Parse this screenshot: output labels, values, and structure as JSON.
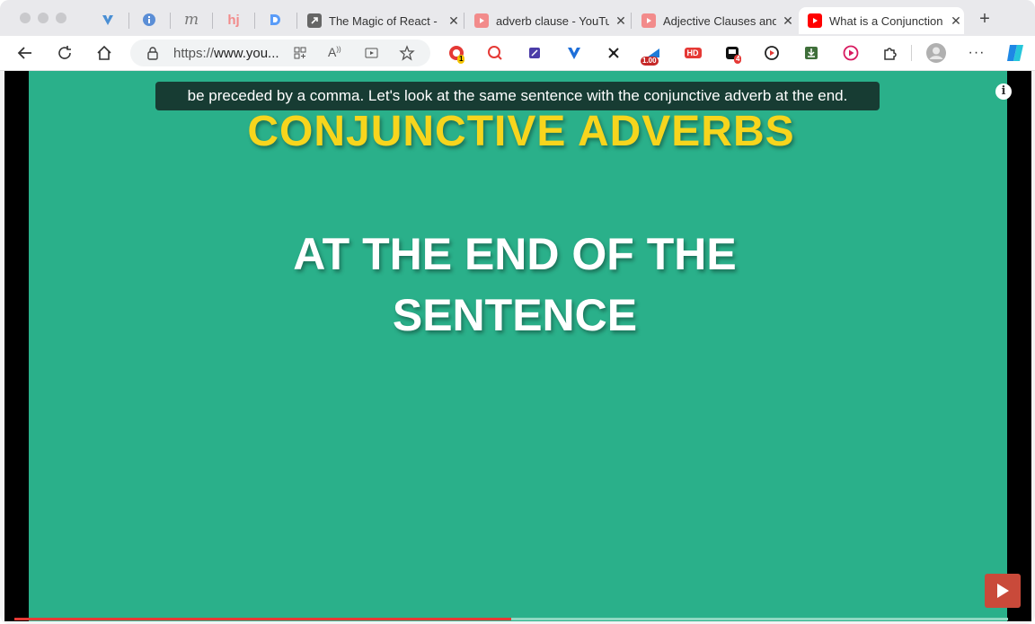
{
  "browser": {
    "pinned_tabs": [
      {
        "icon": "vuetify-icon",
        "color": "#4a8fd4"
      },
      {
        "icon": "info-icon",
        "color": "#5b8ed6"
      },
      {
        "icon": "m-letter-icon",
        "color": "#777777"
      },
      {
        "icon": "hj-icon",
        "color": "#f28b8b"
      },
      {
        "icon": "d-letter-icon",
        "color": "#3b82f6"
      }
    ],
    "tabs": [
      {
        "title": "The Magic of React -",
        "icon": "arrow-link-icon",
        "active": false
      },
      {
        "title": "adverb clause - YouTube",
        "icon": "youtube-icon",
        "active": false
      },
      {
        "title": "Adjective Clauses and",
        "icon": "youtube-icon",
        "active": false
      },
      {
        "title": "What is a Conjunction",
        "icon": "youtube-icon",
        "active": true
      }
    ],
    "address": {
      "url_prefix": "https://",
      "url_host": "www.you..."
    },
    "extensions": {
      "rec_badge": "1",
      "speed_badge": "1.00",
      "hd_label": "HD",
      "count_badge": "4"
    },
    "colors": {
      "youtube_red": "#ff0000",
      "accent": "#2ab08a"
    }
  },
  "video": {
    "caption": "be preceded by a comma. Let's look at the same  sentence with the conjunctive adverb at the end.",
    "title_line": "CONJUNCTIVE ADVERBS",
    "subtitle_lines": [
      "AT THE END OF THE",
      "SENTENCE"
    ],
    "info_label": "i",
    "progress_fraction": 0.5
  }
}
